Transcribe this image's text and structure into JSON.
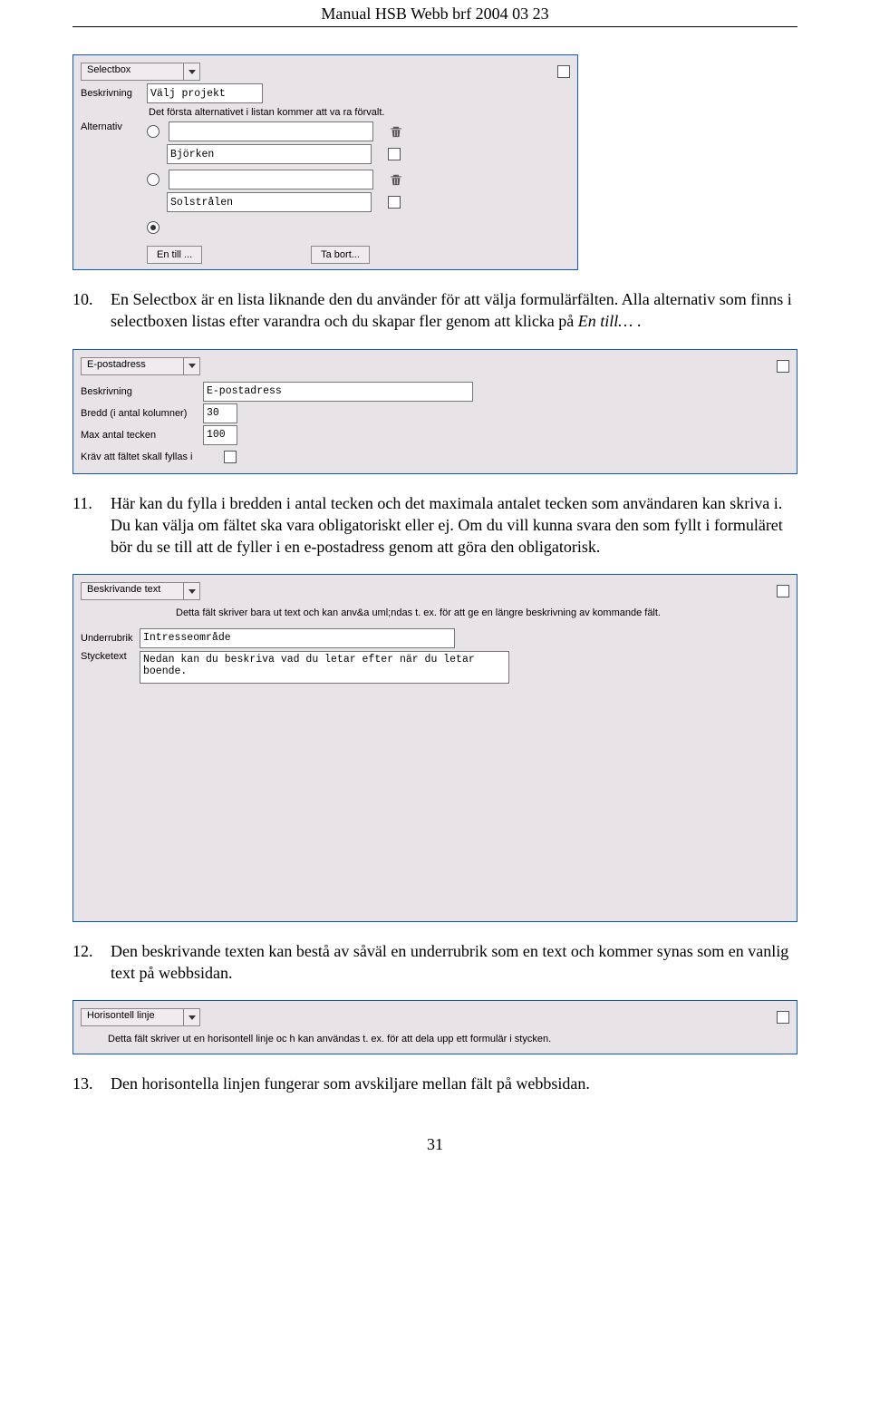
{
  "header": "Manual HSB Webb brf 2004 03 23",
  "page_number": "31",
  "box1": {
    "title": "Selectbox",
    "beskrivning_label": "Beskrivning",
    "beskrivning_value": "Välj projekt",
    "beskrivning_hint": "Det första alternativet i listan kommer att va ra förvalt.",
    "alternativ_label": "Alternativ",
    "alt1_value": "Björken",
    "alt2_value": "Solstrålen",
    "btn_add": "En till ...",
    "btn_remove": "Ta bort..."
  },
  "para10": {
    "num": "10.",
    "text_a": "En Selectbox är en lista liknande den du använder för att välja formulärfälten. Alla alternativ som finns i selectboxen listas efter varandra och du skapar fler genom att klicka på ",
    "text_italic": "En till…",
    "text_b": " ."
  },
  "box2": {
    "title": "E-postadress",
    "beskrivning_label": "Beskrivning",
    "beskrivning_value": "E-postadress",
    "bredd_label": "Bredd (i antal kolumner)",
    "bredd_value": "30",
    "max_label": "Max antal tecken",
    "max_value": "100",
    "krav_label": "Kräv att fältet skall fyllas i"
  },
  "para11": {
    "num": "11.",
    "text": "Här kan du fylla i bredden i antal tecken och det maximala antalet tecken som användaren kan skriva i. Du kan välja om fältet ska vara obligatoriskt eller ej. Om du vill kunna svara den som fyllt i formuläret bör du se till att de fyller i en e-postadress genom att göra den obligatorisk."
  },
  "box3": {
    "title": "Beskrivande text",
    "hint": "Detta fält skriver bara ut text och kan anv&a uml;ndas t. ex. för att ge en längre beskrivning av kommande fält.",
    "underrubrik_label": "Underrubrik",
    "underrubrik_value": "Intresseområde",
    "stycketext_label": "Stycketext",
    "stycketext_value": "Nedan kan du beskriva vad du letar efter när du letar boende."
  },
  "para12": {
    "num": "12.",
    "text": "Den beskrivande texten kan bestå av såväl en underrubrik som en text och kommer synas som en vanlig text på webbsidan."
  },
  "box4": {
    "title": "Horisontell linje",
    "hint": "Detta fält skriver ut en horisontell linje oc h kan användas t. ex. för att dela upp ett formulär i stycken."
  },
  "para13": {
    "num": "13.",
    "text": "Den horisontella linjen fungerar som avskiljare mellan fält på webbsidan."
  }
}
